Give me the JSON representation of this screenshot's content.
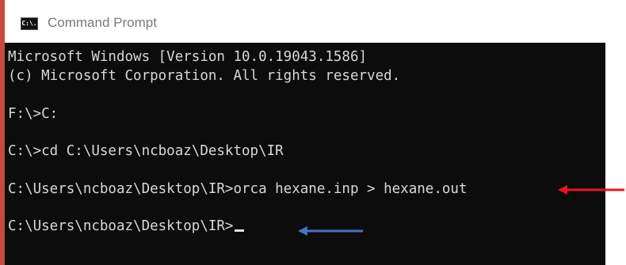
{
  "window": {
    "title": "Command Prompt",
    "icon": "console-icon",
    "icon_glyph": "C:\\."
  },
  "console": {
    "lines": [
      "Microsoft Windows [Version 10.0.19043.1586]",
      "(c) Microsoft Corporation. All rights reserved.",
      "",
      "F:\\>C:",
      "",
      "C:\\>cd C:\\Users\\ncboaz\\Desktop\\IR",
      "",
      "C:\\Users\\ncboaz\\Desktop\\IR>orca hexane.inp > hexane.out",
      "",
      "C:\\Users\\ncboaz\\Desktop\\IR>"
    ]
  },
  "annotations": {
    "red_arrow": {
      "color": "#e8141c",
      "direction": "left"
    },
    "blue_arrow": {
      "color": "#4472c4",
      "direction": "left"
    }
  },
  "colors": {
    "console_bg": "#0c0c0c",
    "console_text": "#d8d8d8",
    "title_text": "#7a7a7a",
    "left_border": "#c64a3a"
  }
}
